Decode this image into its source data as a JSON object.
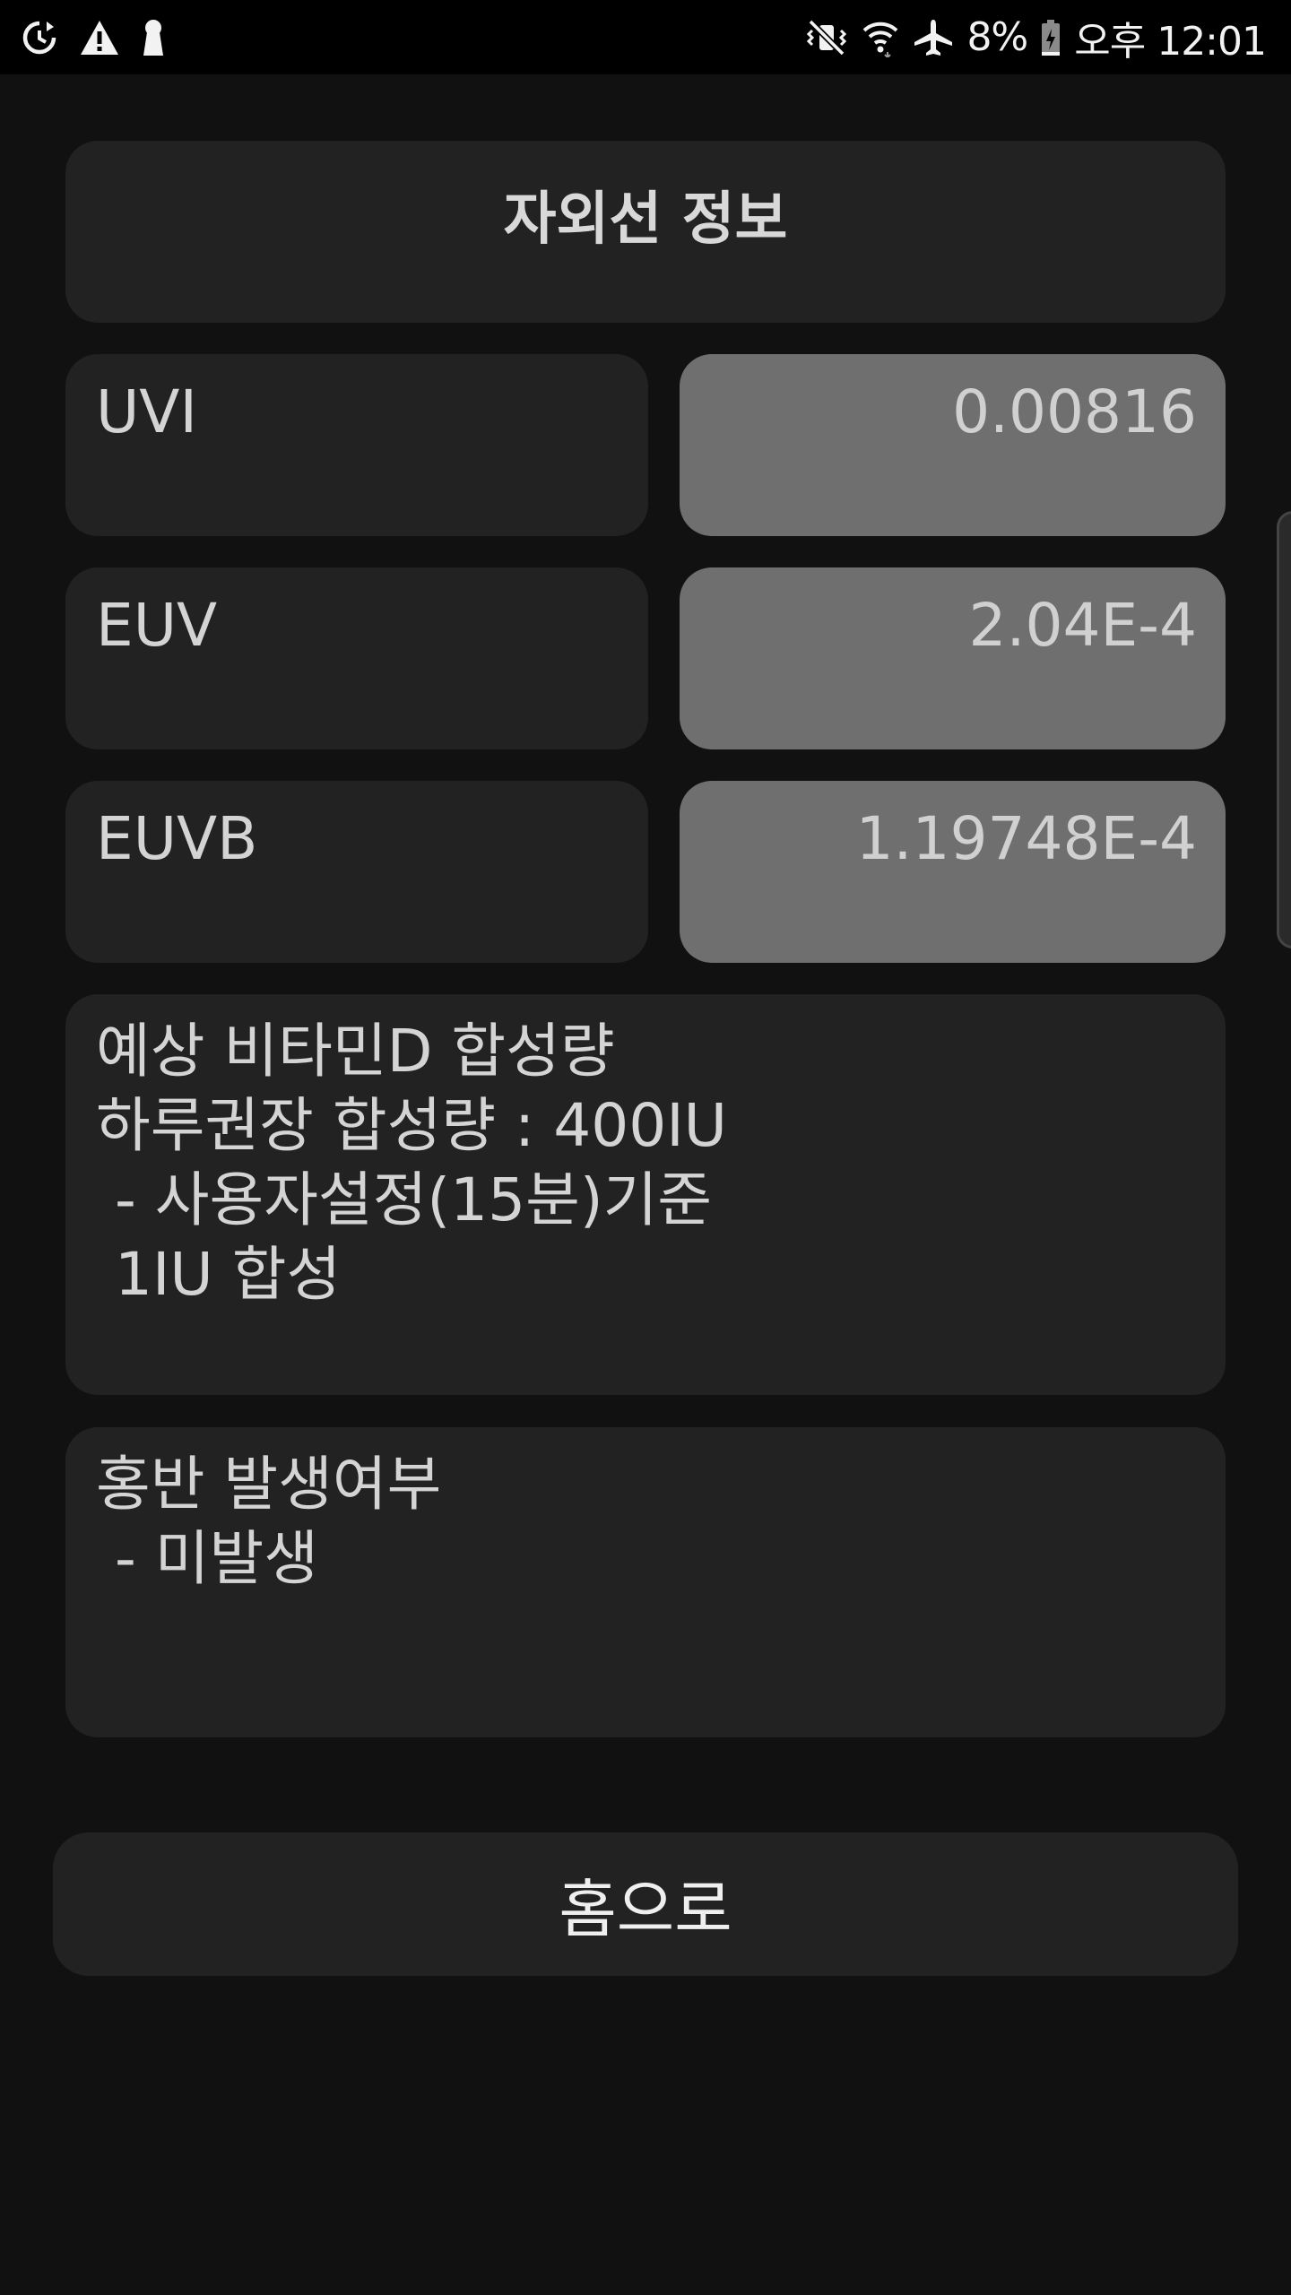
{
  "status_bar": {
    "icons_left": [
      "sync-icon",
      "warning-icon",
      "keyhole-icon"
    ],
    "icons_right": [
      "mute-vibrate-icon",
      "wifi-icon",
      "airplane-icon",
      "battery-icon"
    ],
    "battery_percent": "8%",
    "time": "오후 12:01"
  },
  "header": {
    "title": "자외선 정보"
  },
  "metrics": [
    {
      "label": "UVI",
      "value": "0.00816"
    },
    {
      "label": "EUV",
      "value": "2.04E-4"
    },
    {
      "label": "EUVB",
      "value": "1.19748E-4"
    }
  ],
  "vitamin_d": {
    "text": "예상 비타민D 합성량\n하루권장 합성량 : 400IU\n - 사용자설정(15분)기준\n 1IU 합성"
  },
  "erythema": {
    "text": "홍반 발생여부\n - 미발생"
  },
  "home_button": {
    "label": "홈으로"
  },
  "colors": {
    "background": "#111111",
    "card": "#222222",
    "value_card": "#6f6f6f",
    "status_bar": "#000000"
  }
}
